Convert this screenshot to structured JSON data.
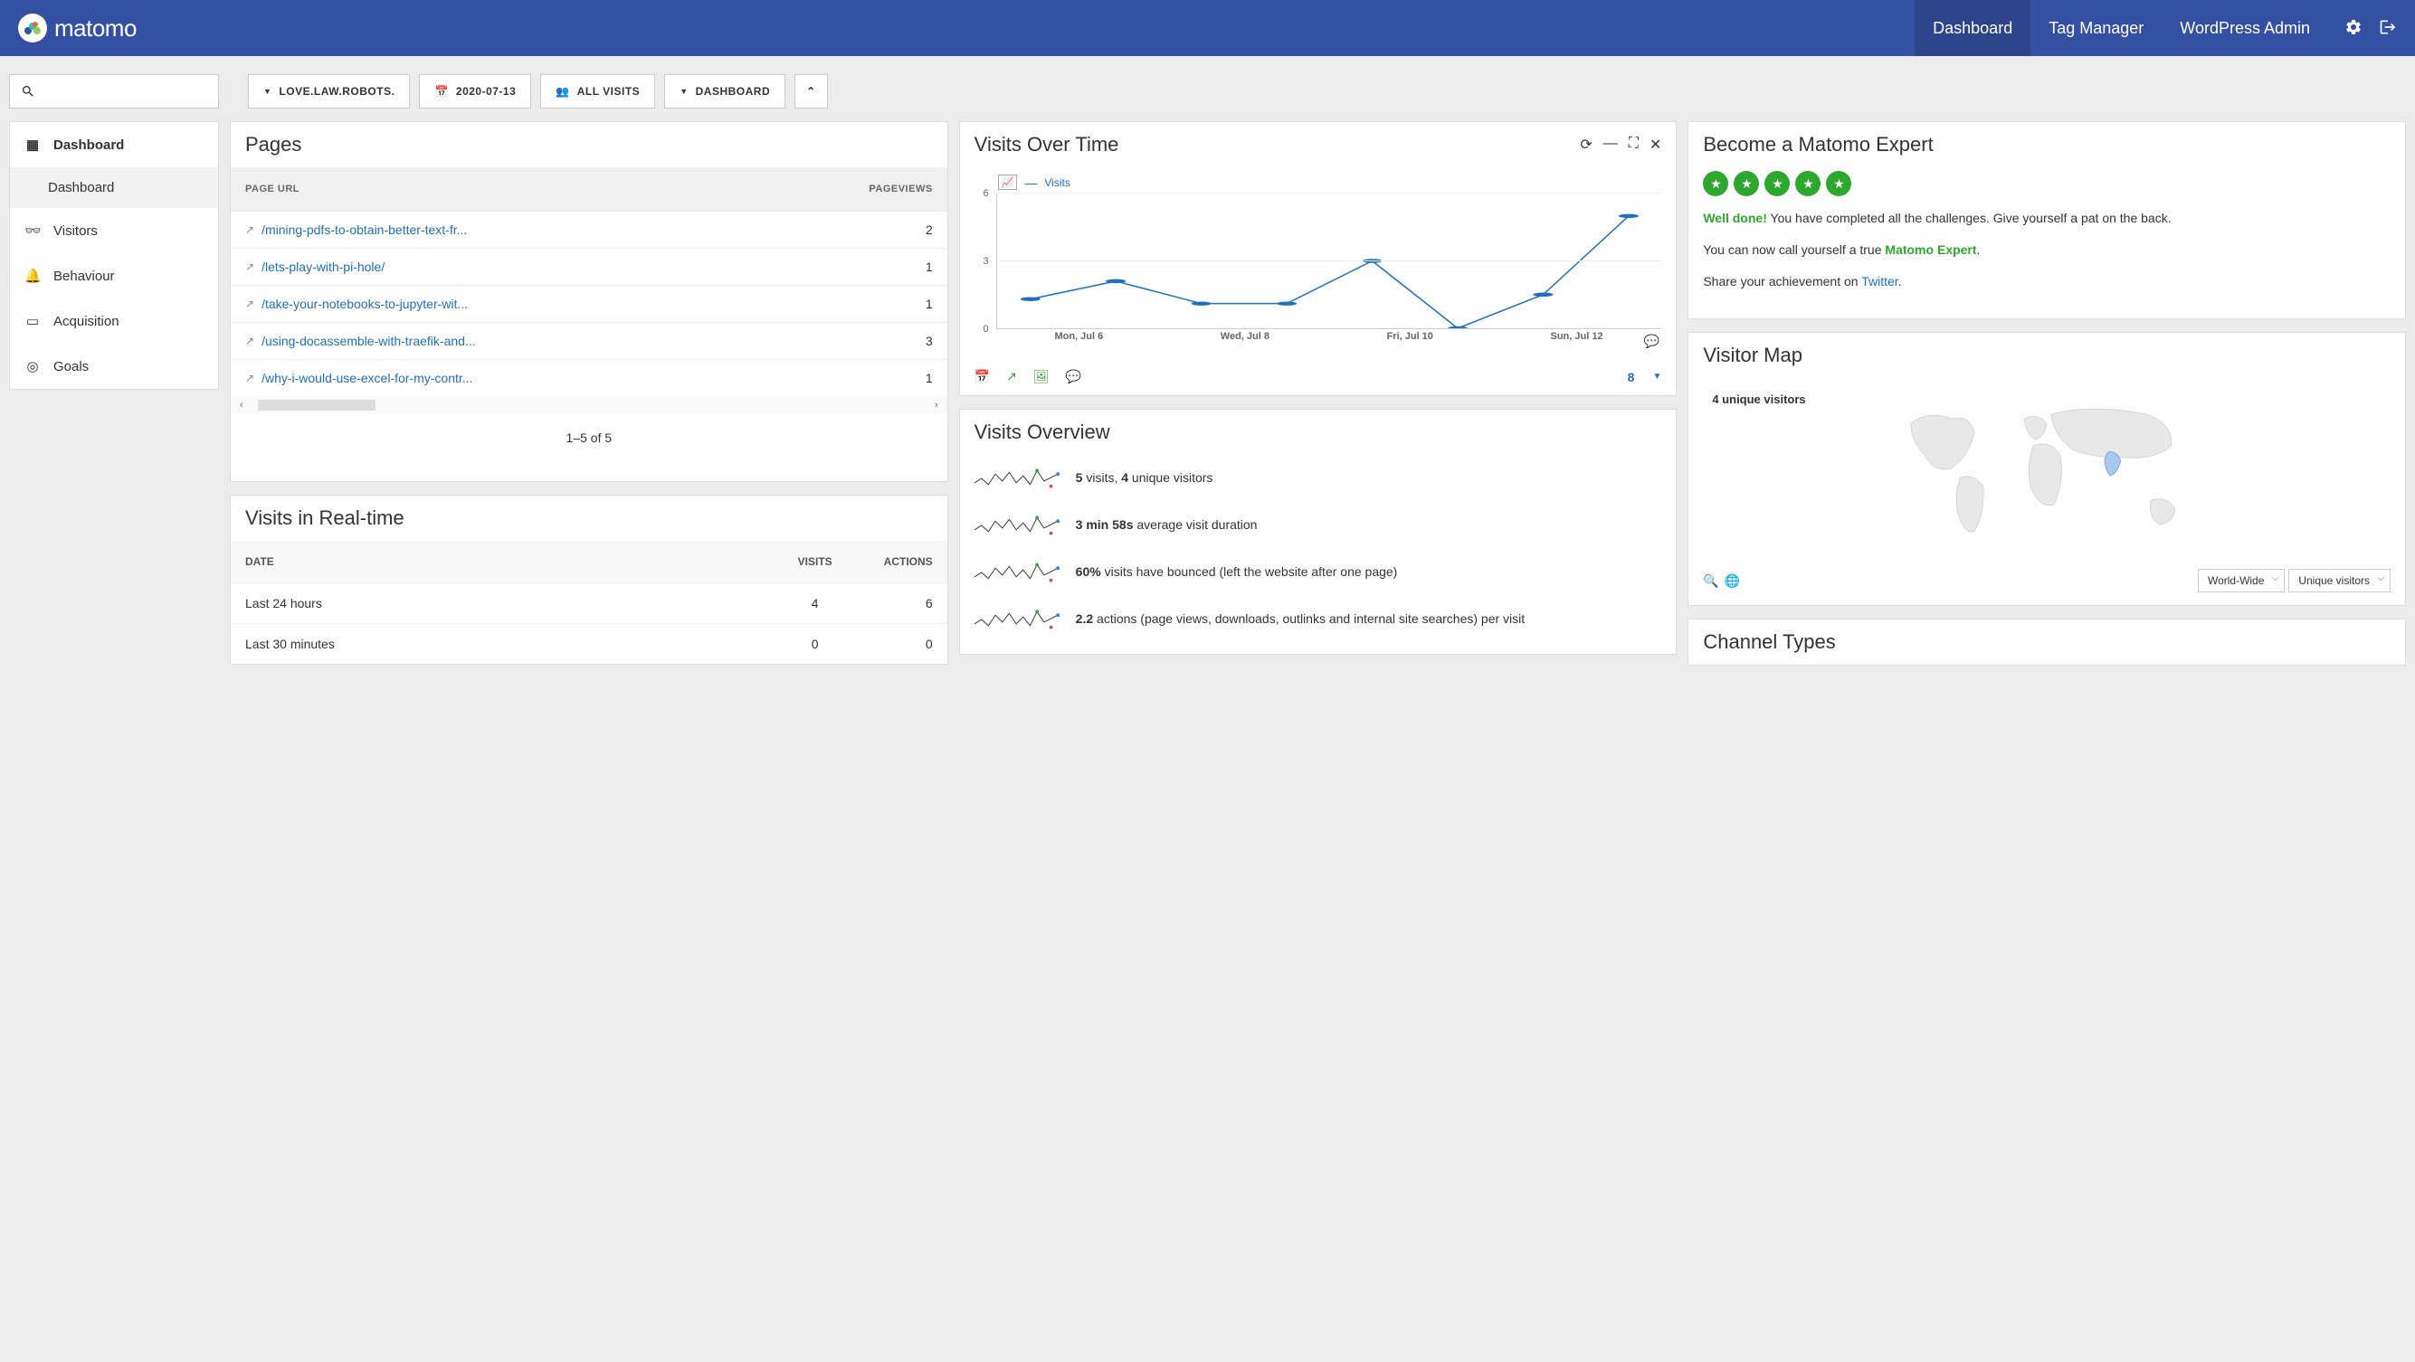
{
  "brand": "matomo",
  "topnav": {
    "dashboard": "Dashboard",
    "tag_manager": "Tag Manager",
    "wp_admin": "WordPress Admin"
  },
  "controls": {
    "site": "LOVE.LAW.ROBOTS.",
    "date": "2020-07-13",
    "segment": "ALL VISITS",
    "dashboard": "DASHBOARD"
  },
  "sidebar": {
    "dashboard": "Dashboard",
    "dashboard_sub": "Dashboard",
    "visitors": "Visitors",
    "behaviour": "Behaviour",
    "acquisition": "Acquisition",
    "goals": "Goals"
  },
  "pages": {
    "title": "Pages",
    "col_url": "PAGE URL",
    "col_views": "PAGEVIEWS",
    "rows": [
      {
        "url": "/mining-pdfs-to-obtain-better-text-fr...",
        "views": "2"
      },
      {
        "url": "/lets-play-with-pi-hole/",
        "views": "1"
      },
      {
        "url": "/take-your-notebooks-to-jupyter-wit...",
        "views": "1"
      },
      {
        "url": "/using-docassemble-with-traefik-and...",
        "views": "3"
      },
      {
        "url": "/why-i-would-use-excel-for-my-contr...",
        "views": "1"
      }
    ],
    "pagination": "1–5 of 5"
  },
  "realtime": {
    "title": "Visits in Real-time",
    "col_date": "DATE",
    "col_visits": "VISITS",
    "col_actions": "ACTIONS",
    "rows": [
      {
        "date": "Last 24 hours",
        "visits": "4",
        "actions": "6"
      },
      {
        "date": "Last 30 minutes",
        "visits": "0",
        "actions": "0"
      }
    ]
  },
  "visits_over_time": {
    "title": "Visits Over Time",
    "legend": "Visits",
    "footer_count": "8"
  },
  "chart_data": {
    "type": "line",
    "title": "Visits Over Time",
    "series_name": "Visits",
    "x": [
      "Mon, Jul 6",
      "Tue, Jul 7",
      "Wed, Jul 8",
      "Thu, Jul 9",
      "Fri, Jul 10",
      "Sat, Jul 11",
      "Sun, Jul 12",
      "Mon, Jul 13"
    ],
    "y": [
      1.3,
      2.1,
      1.1,
      1.1,
      3,
      0,
      1.5,
      5
    ],
    "x_ticks": [
      "Mon, Jul 6",
      "Wed, Jul 8",
      "Fri, Jul 10",
      "Sun, Jul 12"
    ],
    "y_ticks": [
      0,
      3,
      6
    ],
    "ylim": [
      0,
      6
    ]
  },
  "overview": {
    "title": "Visits Overview",
    "rows": [
      {
        "bold1": "5",
        "text1": " visits, ",
        "bold2": "4",
        "text2": " unique visitors"
      },
      {
        "bold1": "3 min 58s",
        "text1": " average visit duration",
        "bold2": "",
        "text2": ""
      },
      {
        "bold1": "60%",
        "text1": " visits have bounced (left the website after one page)",
        "bold2": "",
        "text2": ""
      },
      {
        "bold1": "2.2",
        "text1": " actions (page views, downloads, outlinks and internal site searches) per visit",
        "bold2": "",
        "text2": ""
      }
    ]
  },
  "expert": {
    "title": "Become a Matomo Expert",
    "well_done": "Well done!",
    "text1": " You have completed all the challenges. Give yourself a pat on the back.",
    "text2a": "You can now call yourself a true ",
    "text2b": "Matomo Expert",
    "text3a": "Share your achievement on ",
    "text3b": "Twitter"
  },
  "map": {
    "title": "Visitor Map",
    "label": "4 unique visitors",
    "select1": "World-Wide",
    "select2": "Unique visitors"
  },
  "channels": {
    "title": "Channel Types"
  }
}
